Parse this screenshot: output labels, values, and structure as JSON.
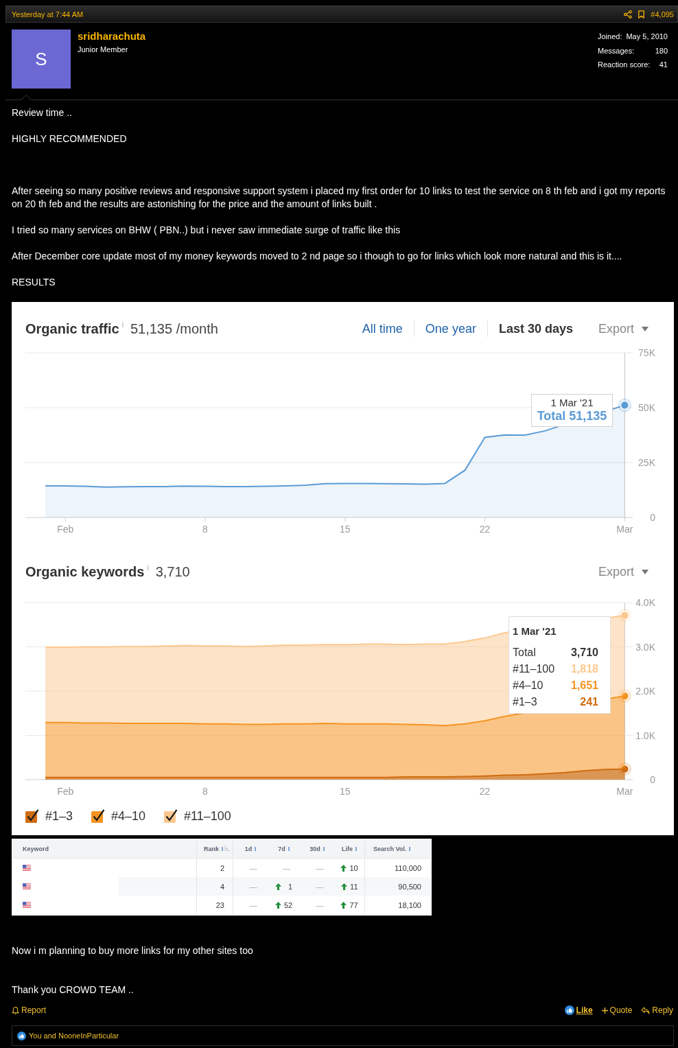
{
  "post_header": {
    "time": "Yesterday at 7:44 AM",
    "post_number": "#4,095"
  },
  "author": {
    "avatar_letter": "S",
    "name": "sridharachuta",
    "title": "Junior Member",
    "stats": [
      {
        "label": "Joined:",
        "value": "May 5, 2010"
      },
      {
        "label": "Messages:",
        "value": "180"
      },
      {
        "label": "Reaction score:",
        "value": "41"
      }
    ]
  },
  "intro": [
    "Review time ..",
    "HIGHLY RECOMMENDED"
  ],
  "story": [
    "After seeing so many positive reviews and responsive support system i placed my first order for 10 links to test the service on 8 th feb and i got my reports on 20 th feb and the results are astonishing for the price and the amount of links built .",
    "I tried so many services on BHW ( PBN..) but i never saw immediate surge of traffic like this",
    "After December core update most of my money keywords moved to 2 nd page so i though to go for links which look more natural and this is it....",
    "RESULTS"
  ],
  "traffic": {
    "title": "Organic traffic",
    "info": "i",
    "summary": "51,135 /month",
    "ranges": [
      {
        "label": "All time",
        "selected": false
      },
      {
        "label": "One year",
        "selected": false
      },
      {
        "label": "Last 30 days",
        "selected": true
      }
    ],
    "export": "Export",
    "tooltip": {
      "date": "1 Mar '21",
      "value": "51,135"
    },
    "chart_data": {
      "type": "area",
      "grid": true,
      "x": [
        0,
        1,
        2,
        3,
        4,
        5,
        6,
        7,
        8,
        9,
        10,
        11,
        12,
        13,
        14,
        15,
        16,
        17,
        18,
        19,
        20,
        21,
        22,
        23,
        24,
        25,
        26,
        27,
        28,
        29
      ],
      "xlim": [
        -1,
        29.4
      ],
      "ylim": [
        0,
        75000
      ],
      "xticks": [
        {
          "value": 1,
          "label": "Feb"
        },
        {
          "value": 8,
          "label": "8"
        },
        {
          "value": 15,
          "label": "15"
        },
        {
          "value": 22,
          "label": "22"
        },
        {
          "value": 29,
          "label": "Mar"
        }
      ],
      "yticks": [
        {
          "value": 0,
          "label": "0"
        },
        {
          "value": 25000,
          "label": "25K"
        },
        {
          "value": 50000,
          "label": "50K"
        },
        {
          "value": 75000,
          "label": "75K"
        }
      ],
      "series": [
        {
          "name": "Total",
          "color": "#5b9bd5",
          "values": [
            14400,
            14400,
            14200,
            13800,
            14000,
            14100,
            14100,
            14300,
            14200,
            14100,
            14100,
            14200,
            14400,
            14700,
            15400,
            15500,
            15500,
            15400,
            15300,
            15200,
            15500,
            21500,
            36500,
            37600,
            37500,
            39400,
            null,
            null,
            null,
            51135
          ]
        }
      ]
    }
  },
  "keywords": {
    "title": "Organic keywords",
    "info": "i",
    "summary": "3,710",
    "export": "Export",
    "tooltip": {
      "date": "1 Mar '21",
      "rows": [
        {
          "label": "Total",
          "value": "3,710",
          "color": "#333333"
        },
        {
          "label": "#11–100",
          "value": "1,818",
          "color": "#fcc88f"
        },
        {
          "label": "#4–10",
          "value": "1,651",
          "color": "#f59422"
        },
        {
          "label": "#1–3",
          "value": "241",
          "color": "#cf6d12"
        }
      ]
    },
    "legend": [
      {
        "checked": true
      },
      {
        "checked": true
      },
      {
        "checked": true
      }
    ],
    "chart_data": {
      "type": "area",
      "stacked": true,
      "grid": true,
      "legend": "bottom",
      "x": [
        0,
        1,
        2,
        3,
        4,
        5,
        6,
        7,
        8,
        9,
        10,
        11,
        12,
        13,
        14,
        15,
        16,
        17,
        18,
        19,
        20,
        21,
        22,
        23,
        24,
        25,
        26,
        27,
        28,
        29
      ],
      "xlim": [
        -1,
        29.4
      ],
      "ylim": [
        0,
        4000
      ],
      "xticks": [
        {
          "value": 1,
          "label": "Feb"
        },
        {
          "value": 8,
          "label": "8"
        },
        {
          "value": 15,
          "label": "15"
        },
        {
          "value": 22,
          "label": "22"
        },
        {
          "value": 29,
          "label": "Mar"
        }
      ],
      "yticks": [
        {
          "value": 0,
          "label": "0"
        },
        {
          "value": 1000,
          "label": "1.0K"
        },
        {
          "value": 2000,
          "label": "2.0K"
        },
        {
          "value": 3000,
          "label": "3.0K"
        },
        {
          "value": 4000,
          "label": "4.0K"
        }
      ],
      "series": [
        {
          "name": "#1–3",
          "color": "#cf6d12",
          "values": [
            50,
            50,
            50,
            50,
            50,
            50,
            50,
            50,
            50,
            50,
            50,
            50,
            50,
            50,
            50,
            50,
            50,
            50,
            60,
            60,
            60,
            70,
            80,
            100,
            110,
            130,
            160,
            200,
            230,
            241
          ]
        },
        {
          "name": "#4–10",
          "color": "#f59422",
          "values": [
            1240,
            1240,
            1230,
            1230,
            1220,
            1220,
            1220,
            1220,
            1210,
            1210,
            1200,
            1200,
            1210,
            1210,
            1220,
            1210,
            1210,
            1210,
            1190,
            1180,
            1160,
            1190,
            1250,
            1330,
            null,
            null,
            null,
            null,
            null,
            1651
          ]
        },
        {
          "name": "#11–100",
          "color": "#fcc88f",
          "values": [
            1700,
            1700,
            1720,
            1720,
            1740,
            1740,
            1750,
            1760,
            1760,
            1760,
            1760,
            1770,
            1780,
            1780,
            1780,
            1790,
            1800,
            1800,
            1800,
            1820,
            1840,
            1860,
            1870,
            1890,
            null,
            null,
            null,
            null,
            null,
            1818
          ]
        }
      ]
    }
  },
  "keyword_table": {
    "columns": [
      {
        "label": "Keyword",
        "info": false,
        "sorted": false
      },
      {
        "label": "Rank",
        "info": true,
        "sorted": true
      },
      {
        "label": "1d",
        "info": true,
        "sorted": false
      },
      {
        "label": "7d",
        "info": true,
        "sorted": false
      },
      {
        "label": "30d",
        "info": true,
        "sorted": false
      },
      {
        "label": "Life",
        "info": true,
        "sorted": false
      },
      {
        "label": "Search Vol.",
        "info": true,
        "sorted": false
      }
    ],
    "rows": [
      {
        "rank": "2",
        "d1": {
          "text": "—",
          "up": false
        },
        "d7": {
          "text": "—",
          "up": false
        },
        "d30": {
          "text": "—",
          "up": false
        },
        "life": {
          "text": "10",
          "up": true
        },
        "volume": "110,000"
      },
      {
        "rank": "4",
        "d1": {
          "text": "—",
          "up": false
        },
        "d7": {
          "text": "1",
          "up": true
        },
        "d30": {
          "text": "—",
          "up": false
        },
        "life": {
          "text": "11",
          "up": true
        },
        "volume": "90,500"
      },
      {
        "rank": "23",
        "d1": {
          "text": "—",
          "up": false
        },
        "d7": {
          "text": "52",
          "up": true
        },
        "d30": {
          "text": "—",
          "up": false
        },
        "life": {
          "text": "77",
          "up": true
        },
        "volume": "18,100"
      }
    ]
  },
  "closing": [
    "Now i m planning to buy more links for my other sites too",
    "Thank you CROWD TEAM .."
  ],
  "actions": [
    {
      "kind": "report",
      "label": "Report",
      "active": false
    },
    {
      "kind": "like",
      "label": "Like",
      "active": true
    },
    {
      "kind": "quote",
      "label": "Quote",
      "active": false
    },
    {
      "kind": "reply",
      "label": "Reply",
      "active": false
    }
  ],
  "reactions": {
    "text": "You and NooneInParticular"
  }
}
